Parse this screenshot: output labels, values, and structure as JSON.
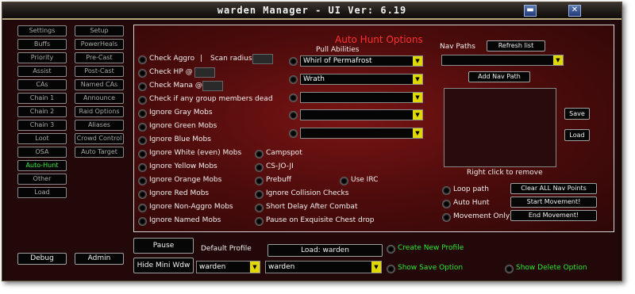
{
  "window": {
    "title": "warden Manager  - UI Ver: 6.19",
    "minimize_glyph": "▬",
    "close_glyph": "✕"
  },
  "sidebar": {
    "left": [
      {
        "label": "Settings"
      },
      {
        "label": "Buffs"
      },
      {
        "label": "Priority"
      },
      {
        "label": "Assist"
      },
      {
        "label": "CAs"
      },
      {
        "label": "Chain 1"
      },
      {
        "label": "Chain 2"
      },
      {
        "label": "Chain 3"
      },
      {
        "label": "Loot"
      },
      {
        "label": "OSA"
      },
      {
        "label": "Auto-Hunt",
        "active": true
      },
      {
        "label": "Other"
      },
      {
        "label": "Load"
      }
    ],
    "right": [
      {
        "label": "Setup"
      },
      {
        "label": "PowerHeals"
      },
      {
        "label": "Pre-Cast"
      },
      {
        "label": "Post-Cast"
      },
      {
        "label": "Named CAs"
      },
      {
        "label": "Announce"
      },
      {
        "label": "Raid Options"
      },
      {
        "label": "Aliases"
      },
      {
        "label": "Crowd Control"
      },
      {
        "label": "Auto Target"
      }
    ],
    "active_color": "#3cf03c"
  },
  "panel": {
    "title": "Auto Hunt Options",
    "title_color": "#ff3030",
    "pull_abilities_label": "Pull Abilities",
    "check_aggro": "Check Aggro",
    "separator": "|",
    "scan_radius": "Scan radius:",
    "check_hp": "Check HP @",
    "check_mana": "Check Mana @",
    "check_group_dead": "Check if any group members dead",
    "ignore_options": [
      "Ignore Gray Mobs",
      "Ignore Green Mobs",
      "Ignore Blue Mobs",
      "Ignore White (even) Mobs",
      "Ignore Yellow Mobs",
      "Ignore Orange Mobs",
      "Ignore Red Mobs",
      "Ignore Non-Aggro Mobs",
      "Ignore Named Mobs"
    ],
    "middle_options": [
      "Campspot",
      "CS-JO-JI",
      "Prebuff",
      "Ignore Collision Checks",
      "Short Delay After Combat",
      "Pause on Exquisite Chest drop"
    ],
    "use_irc": "Use IRC",
    "pull_abilities": [
      "Whirl of Permafrost",
      "Wrath",
      "",
      "",
      ""
    ],
    "nav_paths_label": "Nav Paths",
    "refresh_list": "Refresh list",
    "nav_path_value": "",
    "add_nav_path": "Add Nav Path",
    "save": "Save",
    "load": "Load",
    "right_click_hint": "Right click to remove",
    "loop_path": "Loop path",
    "auto_hunt": "Auto Hunt",
    "movement_only": "Movement Only",
    "clear_nav_points": "Clear ALL Nav Points",
    "start_movement": "Start Movement!",
    "end_movement": "End Movement!"
  },
  "bottom": {
    "debug": "Debug",
    "admin": "Admin",
    "pause": "Pause",
    "hide_mini": "Hide Mini Wdw",
    "default_profile_label": "Default Profile",
    "default_profile_value": "warden",
    "load_profile": "Load: warden",
    "profile_value": "warden",
    "create_new_profile": "Create New Profile",
    "show_save_option": "Show Save Option",
    "show_delete_option": "Show Delete Option"
  },
  "icons": {
    "dropdown_arrow": "▼"
  }
}
